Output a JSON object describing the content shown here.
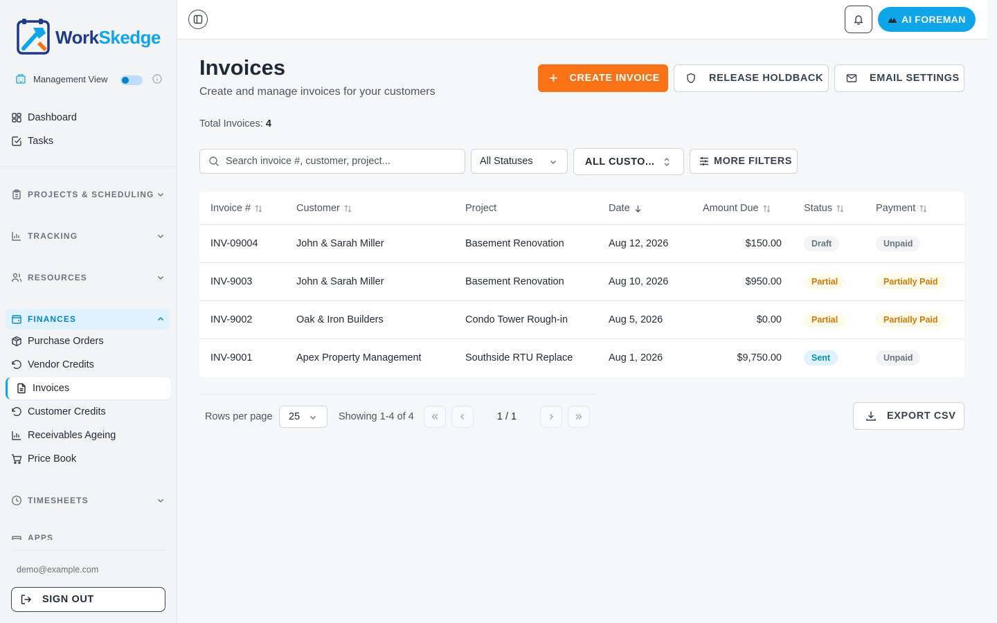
{
  "brand": {
    "name_part1": "Work",
    "name_part2": "Skedge",
    "logo_colors": [
      "#1e3a8a",
      "#0ea5e9",
      "#f97316"
    ]
  },
  "sidebar": {
    "view_label": "Management View",
    "view_toggle_on": true,
    "top_items": [
      {
        "label": "Dashboard",
        "icon": "grid-icon"
      },
      {
        "label": "Tasks",
        "icon": "check-square-icon"
      }
    ],
    "sections": [
      {
        "label": "PROJECTS & SCHEDULING",
        "icon": "clipboard-icon",
        "expanded": false
      },
      {
        "label": "TRACKING",
        "icon": "bar-chart-icon",
        "expanded": false
      },
      {
        "label": "RESOURCES",
        "icon": "users-icon",
        "expanded": false
      },
      {
        "label": "FINANCES",
        "icon": "wallet-icon",
        "expanded": true
      },
      {
        "label": "TIMESHEETS",
        "icon": "clock-icon",
        "expanded": false
      },
      {
        "label": "APPS",
        "icon": "apps-icon",
        "expanded": false
      }
    ],
    "finance_items": [
      {
        "label": "Purchase Orders",
        "icon": "package-icon"
      },
      {
        "label": "Vendor Credits",
        "icon": "rotate-ccw-icon"
      },
      {
        "label": "Invoices",
        "icon": "file-text-icon",
        "active": true
      },
      {
        "label": "Customer Credits",
        "icon": "rotate-ccw-icon"
      },
      {
        "label": "Receivables Ageing",
        "icon": "bar-chart-icon"
      },
      {
        "label": "Price Book",
        "icon": "cart-icon"
      }
    ],
    "user_email": "demo@example.com",
    "signout_label": "SIGN OUT"
  },
  "topbar": {
    "ai_label": "AI FOREMAN"
  },
  "page": {
    "title": "Invoices",
    "subtitle": "Create and manage invoices for your customers",
    "total_label": "Total Invoices:",
    "total_value": "4",
    "actions": {
      "create": "CREATE INVOICE",
      "holdback": "RELEASE HOLDBACK",
      "email": "EMAIL SETTINGS"
    },
    "accent_color": "#f97316"
  },
  "filters": {
    "search_placeholder": "Search invoice #, customer, project...",
    "status_value": "All Statuses",
    "customer_value": "ALL CUSTO...",
    "more_label": "MORE FILTERS"
  },
  "table": {
    "columns": [
      "Invoice #",
      "Customer",
      "Project",
      "Date",
      "Amount Due",
      "Status",
      "Payment"
    ],
    "rows": [
      {
        "invoice": "INV-09004",
        "customer": "John & Sarah Miller",
        "project": "Basement Renovation",
        "date": "Aug 12, 2026",
        "amount": "$150.00",
        "status": "Draft",
        "status_tone": "grey",
        "payment": "Unpaid",
        "payment_tone": "grey"
      },
      {
        "invoice": "INV-9003",
        "customer": "John & Sarah Miller",
        "project": "Basement Renovation",
        "date": "Aug 10, 2026",
        "amount": "$950.00",
        "status": "Partial",
        "status_tone": "amber",
        "payment": "Partially Paid",
        "payment_tone": "amber"
      },
      {
        "invoice": "INV-9002",
        "customer": "Oak & Iron Builders",
        "project": "Condo Tower Rough-in",
        "date": "Aug 5, 2026",
        "amount": "$0.00",
        "status": "Partial",
        "status_tone": "amber",
        "payment": "Partially Paid",
        "payment_tone": "amber"
      },
      {
        "invoice": "INV-9001",
        "customer": "Apex Property Management",
        "project": "Southside RTU Replace",
        "date": "Aug 1, 2026",
        "amount": "$9,750.00",
        "status": "Sent",
        "status_tone": "cyan",
        "payment": "Unpaid",
        "payment_tone": "grey"
      }
    ]
  },
  "pagination": {
    "rows_label": "Rows per page",
    "rows_value": "25",
    "showing": "Showing 1-4 of 4",
    "page": "1 / 1",
    "export_label": "EXPORT CSV"
  }
}
